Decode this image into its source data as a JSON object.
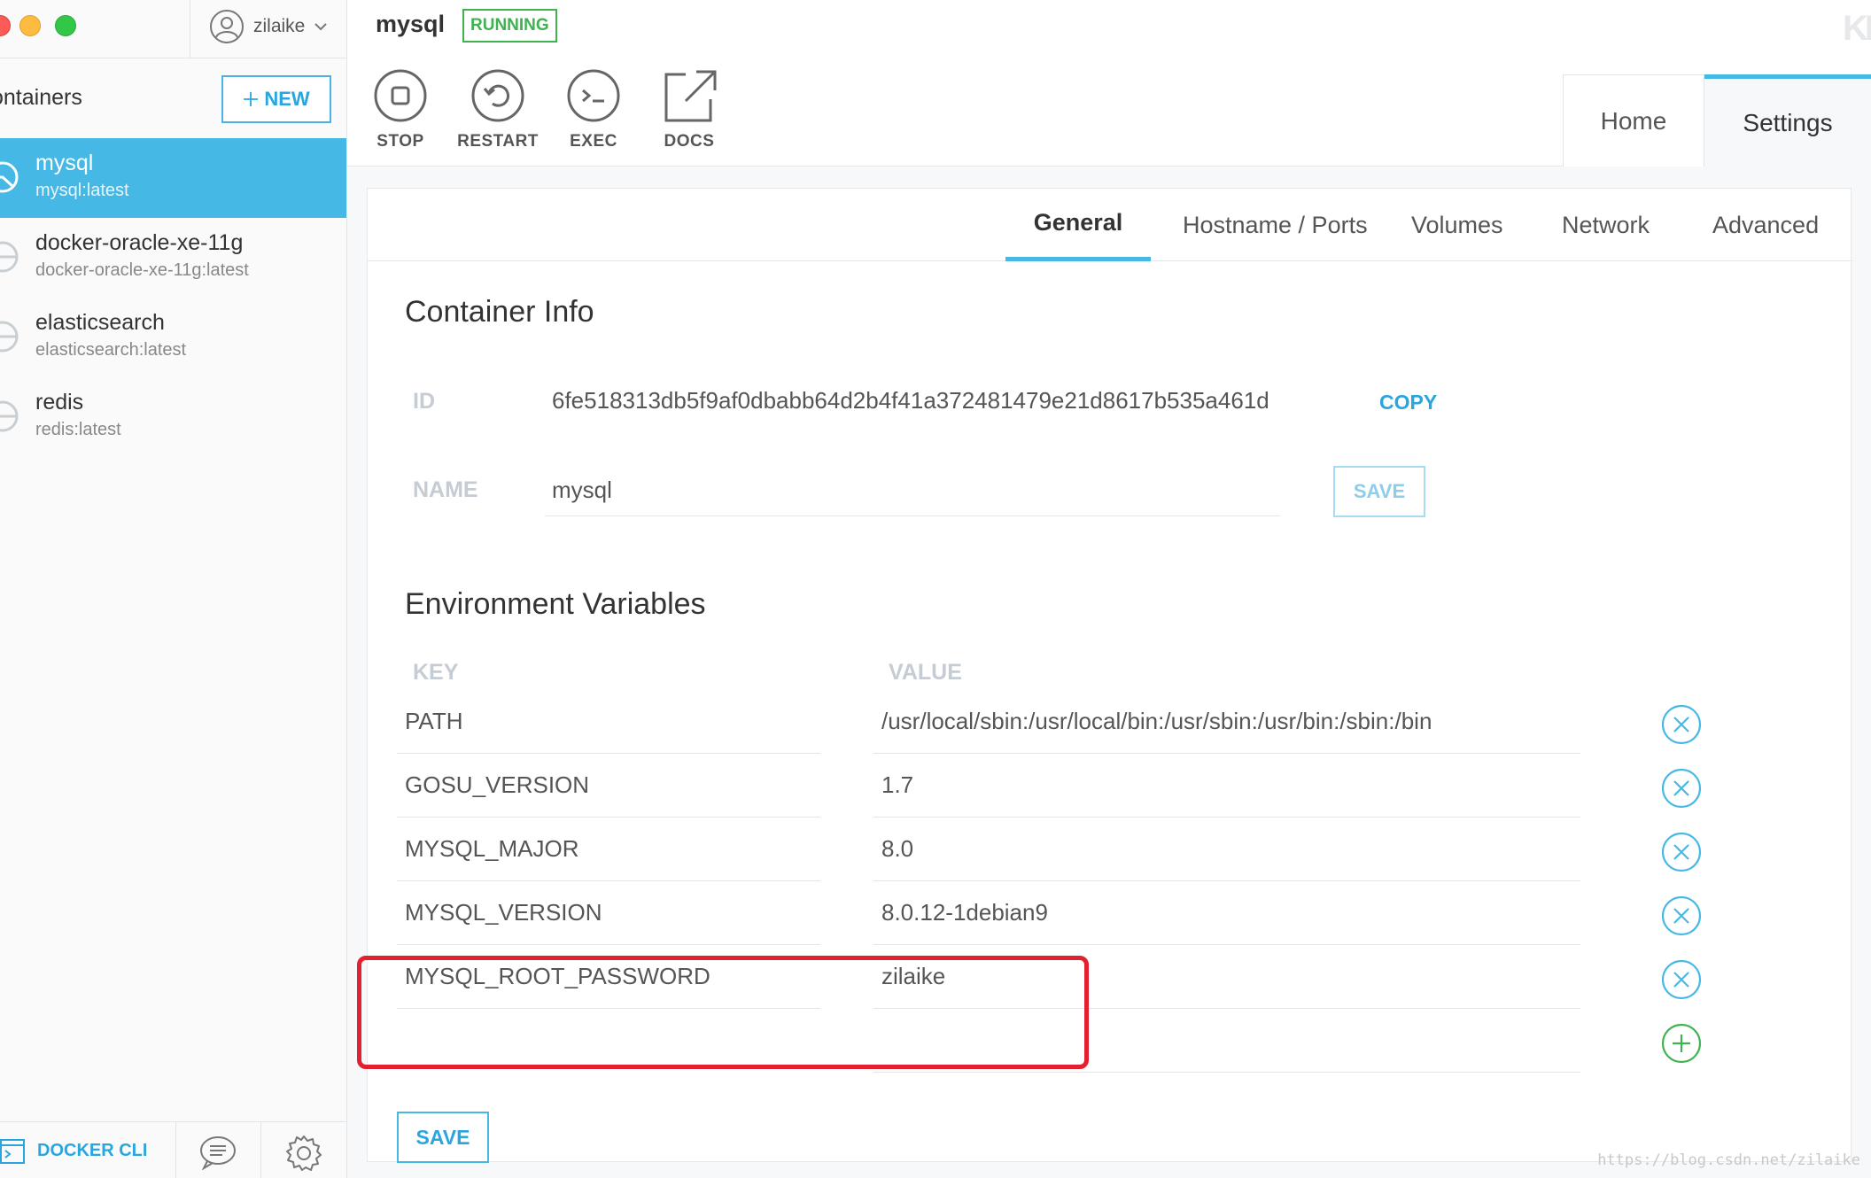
{
  "user": {
    "name": "zilaike"
  },
  "sidebar": {
    "title": "ontainers",
    "new_label": "NEW",
    "containers": [
      {
        "name": "mysql",
        "image": "mysql:latest",
        "active": true
      },
      {
        "name": "docker-oracle-xe-11g",
        "image": "docker-oracle-xe-11g:latest",
        "active": false
      },
      {
        "name": "elasticsearch",
        "image": "elasticsearch:latest",
        "active": false
      },
      {
        "name": "redis",
        "image": "redis:latest",
        "active": false
      }
    ],
    "docker_cli_label": "DOCKER CLI"
  },
  "header": {
    "container_name": "mysql",
    "status": "RUNNING",
    "actions": [
      {
        "label": "STOP",
        "icon": "stop-icon"
      },
      {
        "label": "RESTART",
        "icon": "restart-icon"
      },
      {
        "label": "EXEC",
        "icon": "terminal-icon"
      },
      {
        "label": "DOCS",
        "icon": "external-link-icon"
      }
    ],
    "tabs": {
      "home": "Home",
      "settings": "Settings"
    },
    "logo": "KI"
  },
  "settings": {
    "subtabs": [
      "General",
      "Hostname / Ports",
      "Volumes",
      "Network",
      "Advanced"
    ],
    "active_subtab": "General",
    "container_info": {
      "title": "Container Info",
      "id_label": "ID",
      "id_value": "6fe518313db5f9af0dbabb64d2b4f41a372481479e21d8617b535a461d",
      "copy_label": "COPY",
      "name_label": "NAME",
      "name_value": "mysql",
      "save_label": "SAVE"
    },
    "env": {
      "title": "Environment Variables",
      "key_header": "KEY",
      "value_header": "VALUE",
      "rows": [
        {
          "key": "PATH",
          "value": "/usr/local/sbin:/usr/local/bin:/usr/sbin:/usr/bin:/sbin:/bin"
        },
        {
          "key": "GOSU_VERSION",
          "value": "1.7"
        },
        {
          "key": "MYSQL_MAJOR",
          "value": "8.0"
        },
        {
          "key": "MYSQL_VERSION",
          "value": "8.0.12-1debian9"
        },
        {
          "key": "MYSQL_ROOT_PASSWORD",
          "value": "zilaike"
        }
      ],
      "save_label": "SAVE"
    }
  },
  "colors": {
    "accent": "#45b8e5",
    "running": "#3fb34f",
    "highlight": "#e3202f",
    "add": "#3fb34f"
  },
  "watermark": "https://blog.csdn.net/zilaike"
}
